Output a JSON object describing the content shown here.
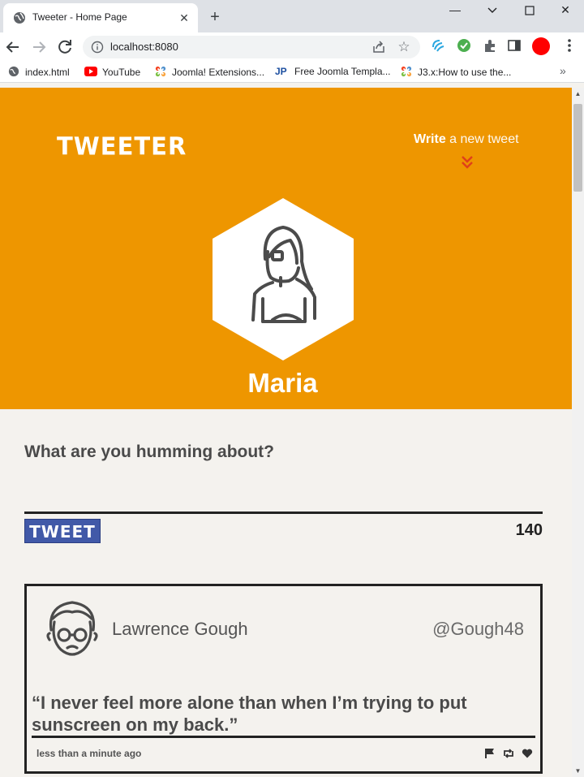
{
  "browser": {
    "tab_title": "Tweeter - Home Page",
    "tab_close": "✕",
    "new_tab": "+",
    "url": "localhost:8080",
    "window_controls": {
      "minimize": "—",
      "maximize": "☐",
      "close": "✕"
    },
    "bookmarks": [
      {
        "label": "index.html",
        "icon": "globe-icon"
      },
      {
        "label": "YouTube",
        "icon": "youtube-icon"
      },
      {
        "label": "Joomla! Extensions...",
        "icon": "joomla-icon"
      },
      {
        "label": "Free Joomla Templa...",
        "icon": "jp-icon"
      },
      {
        "label": "J3.x:How to use the...",
        "icon": "joomla-icon"
      }
    ],
    "bookmarks_more": "»",
    "jp_badge": "JP",
    "colors": {
      "profile_avatar": "#ff0000",
      "tab_strip": "#dee1e6"
    }
  },
  "header": {
    "brand": "TWEETER",
    "write_bold": "Write",
    "write_rest": " a new tweet"
  },
  "profile": {
    "name": "Maria"
  },
  "compose": {
    "prompt": "What are you humming about?",
    "button": "TWEET",
    "counter": "140"
  },
  "tweets": [
    {
      "author": "Lawrence Gough",
      "handle": "@Gough48",
      "text": "“I never feel more alone than when I’m trying to put sunscreen on my back.”",
      "time": "less than a minute ago"
    }
  ],
  "theme": {
    "hero": "#ee9600",
    "tweet_button": "#4159a8",
    "accent_chevron": "#e0401a"
  }
}
